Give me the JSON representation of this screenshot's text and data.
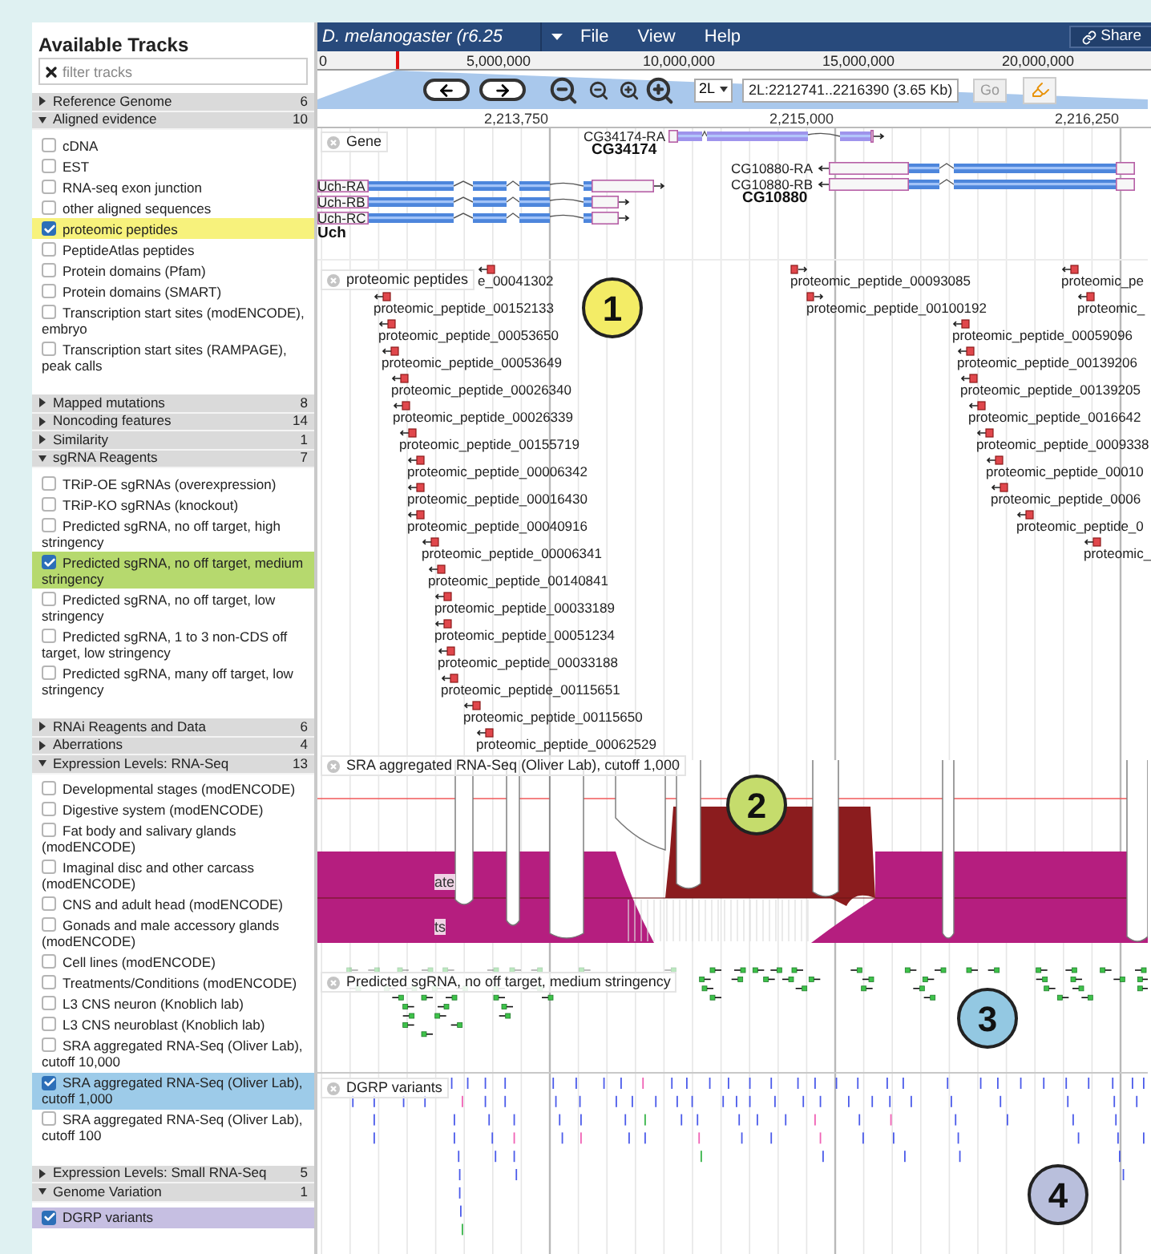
{
  "sidebar": {
    "title": "Available Tracks",
    "filter": {
      "placeholder": "filter tracks"
    },
    "categories": [
      {
        "label": "Reference Genome",
        "count": "6",
        "expanded": false
      },
      {
        "label": "Aligned evidence",
        "count": "10",
        "expanded": true,
        "items": [
          {
            "label": "cDNA",
            "checked": false
          },
          {
            "label": "EST",
            "checked": false
          },
          {
            "label": "RNA-seq exon junction",
            "checked": false
          },
          {
            "label": "other aligned sequences",
            "checked": false
          },
          {
            "label": "proteomic peptides",
            "checked": true,
            "color": "#f7f27c"
          },
          {
            "label": "PeptideAtlas peptides",
            "checked": false
          },
          {
            "label": "Protein domains (Pfam)",
            "checked": false
          },
          {
            "label": "Protein domains (SMART)",
            "checked": false
          },
          {
            "label": "Transcription start sites (modENCODE), embryo",
            "checked": false
          },
          {
            "label": "Transcription start sites (RAMPAGE), peak calls",
            "checked": false
          }
        ]
      },
      {
        "label": "Mapped mutations",
        "count": "8",
        "expanded": false
      },
      {
        "label": "Noncoding features",
        "count": "14",
        "expanded": false
      },
      {
        "label": "Similarity",
        "count": "1",
        "expanded": false
      },
      {
        "label": "sgRNA Reagents",
        "count": "7",
        "expanded": true,
        "items": [
          {
            "label": "TRiP-OE sgRNAs (overexpression)",
            "checked": false
          },
          {
            "label": "TRiP-KO sgRNAs (knockout)",
            "checked": false
          },
          {
            "label": "Predicted sgRNA, no off target, high stringency",
            "checked": false
          },
          {
            "label": "Predicted sgRNA, no off target, medium stringency",
            "checked": true,
            "color": "#b6d96e"
          },
          {
            "label": "Predicted sgRNA, no off target, low stringency",
            "checked": false
          },
          {
            "label": "Predicted sgRNA, 1 to 3 non-CDS off target, low stringency",
            "checked": false
          },
          {
            "label": "Predicted sgRNA, many off target, low stringency",
            "checked": false
          }
        ]
      },
      {
        "label": "RNAi Reagents and Data",
        "count": "6",
        "expanded": false
      },
      {
        "label": "Aberrations",
        "count": "4",
        "expanded": false
      },
      {
        "label": "Expression Levels: RNA-Seq",
        "count": "13",
        "expanded": true,
        "items": [
          {
            "label": "Developmental stages (modENCODE)",
            "checked": false
          },
          {
            "label": "Digestive system (modENCODE)",
            "checked": false
          },
          {
            "label": "Fat body and salivary glands (modENCODE)",
            "checked": false
          },
          {
            "label": "Imaginal disc and other carcass (modENCODE)",
            "checked": false
          },
          {
            "label": "CNS and adult head (modENCODE)",
            "checked": false
          },
          {
            "label": "Gonads and male accessory glands (modENCODE)",
            "checked": false
          },
          {
            "label": "Cell lines (modENCODE)",
            "checked": false
          },
          {
            "label": "Treatments/Conditions (modENCODE)",
            "checked": false
          },
          {
            "label": "L3 CNS neuron (Knoblich lab)",
            "checked": false
          },
          {
            "label": "L3 CNS neuroblast (Knoblich lab)",
            "checked": false
          },
          {
            "label": "SRA aggregated RNA-Seq (Oliver Lab), cutoff 10,000",
            "checked": false
          },
          {
            "label": "SRA aggregated RNA-Seq (Oliver Lab), cutoff 1,000",
            "checked": true,
            "color": "#9dcbe9"
          },
          {
            "label": "SRA aggregated RNA-Seq (Oliver Lab), cutoff 100",
            "checked": false
          }
        ]
      },
      {
        "label": "Expression Levels: Small RNA-Seq",
        "count": "5",
        "expanded": false
      },
      {
        "label": "Genome Variation",
        "count": "1",
        "expanded": true,
        "items": [
          {
            "label": "DGRP variants",
            "checked": true,
            "color": "#c6bfe2"
          }
        ]
      }
    ]
  },
  "header": {
    "title": "D. melanogaster (r6.25",
    "menus": [
      "File",
      "View",
      "Help"
    ],
    "share": "Share"
  },
  "overview": {
    "ticks": [
      "0",
      "5,000,000",
      "10,000,000",
      "15,000,000",
      "20,000,000"
    ]
  },
  "navigation": {
    "chromosome": "2L",
    "location": "2L:2212741..2216390 (3.65 Kb)",
    "go": "Go"
  },
  "ruler": {
    "ticks": [
      "2,213,750",
      "2,215,000",
      "2,216,250"
    ]
  },
  "tracks": [
    {
      "kind": "gene",
      "label": "Gene",
      "genes": [
        {
          "name": "CG34174",
          "transcripts": [
            "CG34174-RA"
          ]
        },
        {
          "name": "CG10880",
          "transcripts": [
            "CG10880-RA",
            "CG10880-RB"
          ]
        },
        {
          "name": "Uch",
          "transcripts": [
            "Uch-RA",
            "Uch-RB",
            "Uch-RC"
          ]
        }
      ]
    },
    {
      "kind": "peptides",
      "label": "proteomic peptides",
      "marker": {
        "text": "1",
        "color": "#f3ec66"
      },
      "features": [
        {
          "label": "e_00041302",
          "forward": false
        },
        {
          "label": "proteomic_peptide_00152133",
          "forward": false
        },
        {
          "label": "proteomic_peptide_00053650",
          "forward": false
        },
        {
          "label": "proteomic_peptide_00053649",
          "forward": false
        },
        {
          "label": "proteomic_peptide_00026340",
          "forward": false
        },
        {
          "label": "proteomic_peptide_00026339",
          "forward": false
        },
        {
          "label": "proteomic_peptide_00155719",
          "forward": false
        },
        {
          "label": "proteomic_peptide_00006342",
          "forward": false
        },
        {
          "label": "proteomic_peptide_00016430",
          "forward": false
        },
        {
          "label": "proteomic_peptide_00040916",
          "forward": false
        },
        {
          "label": "proteomic_peptide_00006341",
          "forward": false
        },
        {
          "label": "proteomic_peptide_00140841",
          "forward": false
        },
        {
          "label": "proteomic_peptide_00033189",
          "forward": false
        },
        {
          "label": "proteomic_peptide_00051234",
          "forward": false
        },
        {
          "label": "proteomic_peptide_00033188",
          "forward": false
        },
        {
          "label": "proteomic_peptide_00115651",
          "forward": false
        },
        {
          "label": "proteomic_peptide_00115650",
          "forward": false
        },
        {
          "label": "proteomic_peptide_00062529",
          "forward": false
        },
        {
          "label": "proteomic_peptide_00093085",
          "forward": true
        },
        {
          "label": "proteomic_peptide_00100192",
          "forward": true
        },
        {
          "label": "proteomic_pe",
          "forward": false
        },
        {
          "label": "proteomic_",
          "forward": false
        },
        {
          "label": "proteomic_peptide_00059096",
          "forward": false
        },
        {
          "label": "proteomic_peptide_00139206",
          "forward": false
        },
        {
          "label": "proteomic_peptide_00139205",
          "forward": false
        },
        {
          "label": "proteomic_peptide_0016642",
          "forward": false
        },
        {
          "label": "proteomic_peptide_0009338",
          "forward": false
        },
        {
          "label": "proteomic_peptide_00010",
          "forward": false
        },
        {
          "label": "proteomic_peptide_0006",
          "forward": false
        },
        {
          "label": "proteomic_peptide_0",
          "forward": false
        },
        {
          "label": "proteomic_",
          "forward": false
        }
      ]
    },
    {
      "kind": "coverage",
      "label": "SRA aggregated RNA-Seq (Oliver Lab), cutoff 1,000",
      "partial_labels": [
        "ate",
        "ts"
      ],
      "marker": {
        "text": "2",
        "color": "#c5dc6c"
      }
    },
    {
      "kind": "sgrna",
      "label": "Predicted sgRNA, no off target, medium stringency",
      "marker": {
        "text": "3",
        "color": "#93c8e2"
      }
    },
    {
      "kind": "variants",
      "label": "DGRP variants",
      "marker": {
        "text": "4",
        "color": "#b9bfdc"
      }
    }
  ]
}
